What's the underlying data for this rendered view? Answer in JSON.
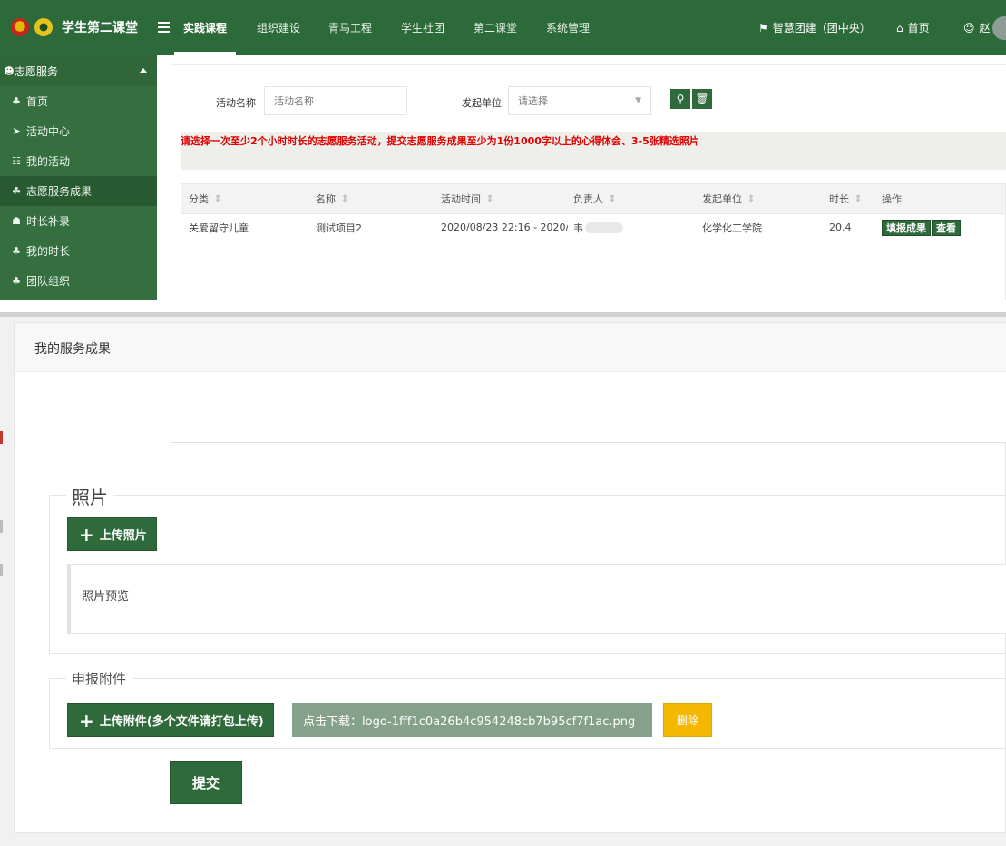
{
  "navbar": {
    "brand_title": "学生第二课堂",
    "items": [
      "实践课程",
      "组织建设",
      "青马工程",
      "学生社团",
      "第二课堂",
      "系统管理"
    ],
    "right": {
      "flag_label": "智慧团建（团中央）",
      "home_label": "首页",
      "user_label": "赵"
    }
  },
  "sidebar": {
    "header": "志愿服务",
    "items": [
      "首页",
      "活动中心",
      "我的活动",
      "志愿服务成果",
      "时长补录",
      "我的时长",
      "团队组织"
    ]
  },
  "filters": {
    "name_label": "活动名称",
    "name_placeholder": "活动名称",
    "org_label": "发起单位",
    "org_placeholder": "请选择"
  },
  "notice": "请选择一次至少2个小时时长的志愿服务活动，提交志愿服务成果至少为1份1000字以上的心得体会、3-5张精选照片",
  "table": {
    "columns": [
      "分类",
      "名称",
      "活动时间",
      "负责人",
      "发起单位",
      "时长",
      "操作"
    ],
    "rows": [
      {
        "category": "关爱留守儿童",
        "name": "测试项目2",
        "time": "2020/08/23 22:16 - 2020/0...",
        "leader": "韦",
        "org": "化学化工学院",
        "hours": "20.4",
        "actions": [
          "填报成果",
          "查看"
        ]
      }
    ]
  },
  "modal": {
    "title": "我的服务成果",
    "photos": {
      "legend": "照片",
      "upload_label": "上传照片",
      "preview_label": "照片预览"
    },
    "attachments": {
      "legend": "申报附件",
      "upload_label": "上传附件(多个文件请打包上传)",
      "download_label": "点击下载：logo-1fff1c0a26b4c954248cb7b95cf7f1ac.png",
      "delete_label": "删除"
    },
    "submit_label": "提交"
  },
  "colors": {
    "brand_green": "#2f6a3b",
    "notice_red": "#e00000",
    "delete_yellow": "#f5b800"
  }
}
